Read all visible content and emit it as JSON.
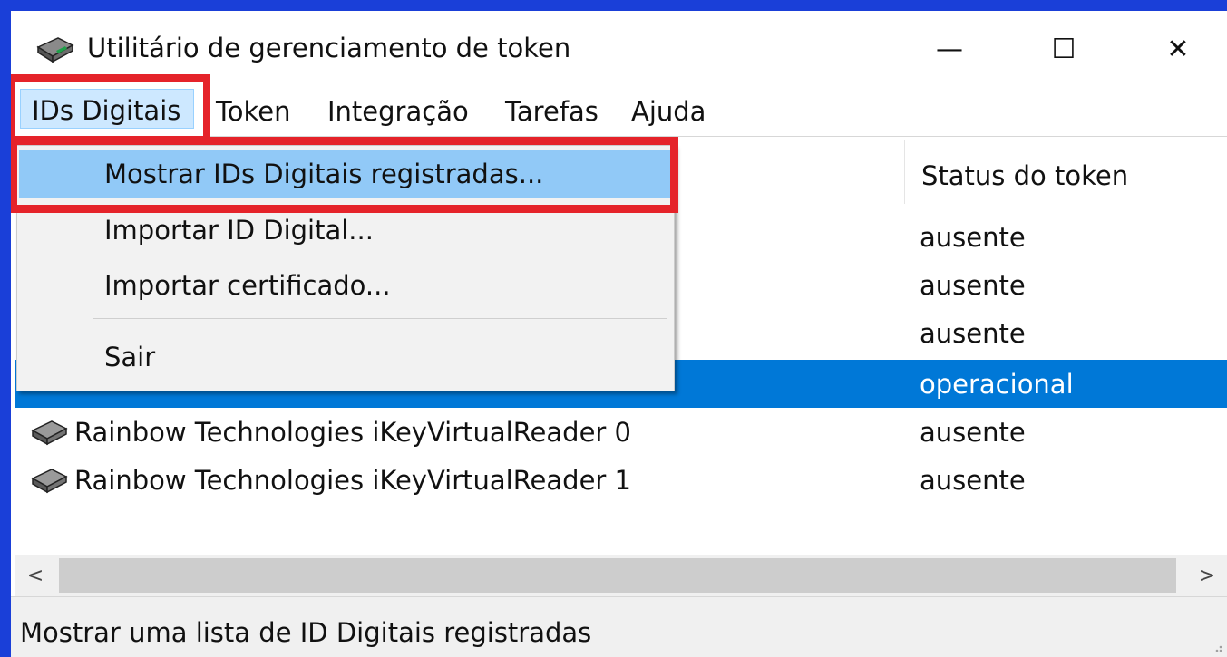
{
  "window": {
    "title": "Utilitário de gerenciamento de token",
    "minimize_glyph": "—",
    "maximize_glyph": "☐",
    "close_glyph": "✕"
  },
  "menubar": {
    "items": [
      "IDs Digitais",
      "Token",
      "Integração",
      "Tarefas",
      "Ajuda"
    ]
  },
  "dropdown": {
    "items": [
      "Mostrar IDs Digitais registradas...",
      "Importar ID Digital...",
      "Importar certificado...",
      "Sair"
    ]
  },
  "list": {
    "column_status": "Status do token",
    "rows": [
      {
        "name": "",
        "status": "ausente"
      },
      {
        "name": "",
        "status": "ausente"
      },
      {
        "name": "",
        "status": "ausente"
      },
      {
        "name": "",
        "status": "operacional"
      },
      {
        "name": "Rainbow Technologies iKeyVirtualReader 0",
        "status": "ausente"
      },
      {
        "name": "Rainbow Technologies iKeyVirtualReader 1",
        "status": "ausente"
      }
    ]
  },
  "scrollbar": {
    "left_arrow": "<",
    "right_arrow": ">"
  },
  "statusbar": {
    "text": "Mostrar uma lista de ID Digitais registradas"
  },
  "colors": {
    "frame_blue": "#1a3fd8",
    "selection_blue": "#0078d7",
    "highlight_red": "#e5232a",
    "menu_hover": "#91c9f7"
  },
  "icons": [
    "token-reader-icon"
  ]
}
